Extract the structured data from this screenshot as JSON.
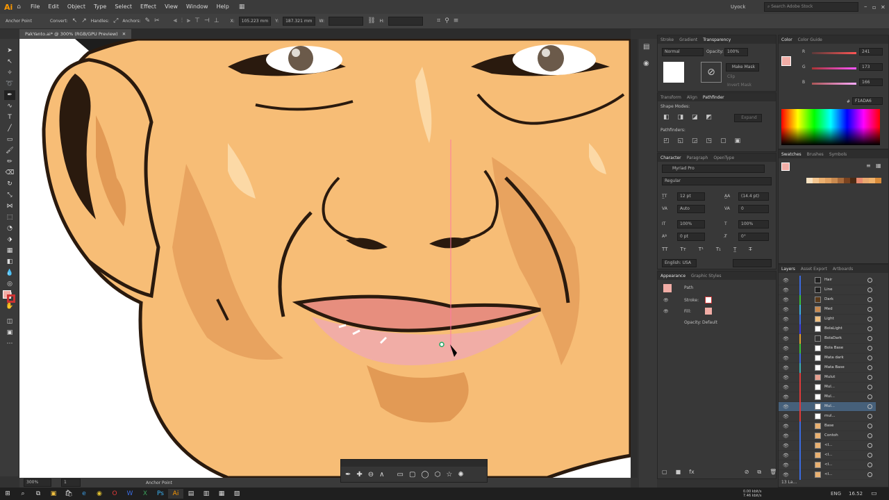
{
  "app": {
    "logo": "Ai",
    "user": "Uyock",
    "search_placeholder": "Search Adobe Stock"
  },
  "menu": [
    "File",
    "Edit",
    "Object",
    "Type",
    "Select",
    "Effect",
    "View",
    "Window",
    "Help"
  ],
  "control_bar": {
    "tool_label": "Anchor Point",
    "convert": "Convert:",
    "handles": "Handles:",
    "anchors": "Anchors:",
    "x_label": "X:",
    "x_value": "105.223 mm",
    "y_label": "Y:",
    "y_value": "187.321 mm",
    "w_label": "W:",
    "h_label": "H:"
  },
  "document": {
    "tab": "PakYanto.ai* @ 300% (RGB/GPU Preview)",
    "zoom": "300%",
    "page": "1",
    "status_tool": "Anchor Point"
  },
  "transparency": {
    "tabs": [
      "Stroke",
      "Gradient",
      "Transparency"
    ],
    "blend_mode": "Normal",
    "opacity_label": "Opacity:",
    "opacity": "100%",
    "make_mask": "Make Mask",
    "clip": "Clip",
    "invert_mask": "Invert Mask"
  },
  "pathfinder": {
    "tabs": [
      "Transform",
      "Align",
      "Pathfinder"
    ],
    "shape_modes": "Shape Modes:",
    "pathfinders": "Pathfinders:",
    "expand": "Expand"
  },
  "character": {
    "tabs": [
      "Character",
      "Paragraph",
      "OpenType"
    ],
    "font": "Myriad Pro",
    "style": "Regular",
    "size": "12 pt",
    "leading": "(14.4 pt)",
    "kerning": "Auto",
    "tracking": "0",
    "vscale": "100%",
    "hscale": "100%",
    "baseline": "0 pt",
    "rotate": "0°",
    "language": "English: USA"
  },
  "appearance": {
    "tabs": [
      "Appearance",
      "Graphic Styles"
    ],
    "target": "Path",
    "stroke_label": "Stroke:",
    "fill_label": "Fill:",
    "opacity_label": "Opacity:",
    "opacity_value": "Default"
  },
  "color": {
    "tabs": [
      "Color",
      "Color Guide"
    ],
    "r": "241",
    "g": "173",
    "b": "166",
    "hex": "F1ADA6",
    "fill_hex": "#F1ADA6"
  },
  "swatches": {
    "tabs": [
      "Swatches",
      "Brushes",
      "Symbols"
    ],
    "colors": [
      "#f9e3c2",
      "#f3c690",
      "#ebb070",
      "#e0a060",
      "#c98a4f",
      "#a86a3a",
      "#7a4320",
      "#4a2a14",
      "#e88a6e",
      "#e9a86f",
      "#f0b26b",
      "#d98c3a"
    ]
  },
  "layers": {
    "tabs": [
      "Layers",
      "Asset Export",
      "Artboards"
    ],
    "count": "13 La...",
    "items": [
      {
        "name": "Hair",
        "color": "#3a6be0",
        "thumb": "#222"
      },
      {
        "name": "Line",
        "color": "#3a6be0",
        "thumb": "#222"
      },
      {
        "name": "Dark",
        "color": "#3ac03a",
        "thumb": "#5a3a1a"
      },
      {
        "name": "Med",
        "color": "#3ab0e0",
        "thumb": "#c98a4f"
      },
      {
        "name": "Light",
        "color": "#3a6be0",
        "thumb": "#f0c080"
      },
      {
        "name": "BolaLight",
        "color": "#3a3ae0",
        "thumb": "#fff"
      },
      {
        "name": "BolaDark",
        "color": "#e0a030",
        "thumb": "#333"
      },
      {
        "name": "Bola Base",
        "color": "#3ac03a",
        "thumb": "#fff"
      },
      {
        "name": "Mata dark",
        "color": "#3a6be0",
        "thumb": "#fff"
      },
      {
        "name": "Mata Base",
        "color": "#3ab0b0",
        "thumb": "#fff"
      },
      {
        "name": "Mulut",
        "color": "#e03a3a",
        "thumb": "#e8a090"
      },
      {
        "name": "Mul...",
        "color": "#e03a3a",
        "thumb": "#fff"
      },
      {
        "name": "Mul...",
        "color": "#e03a3a",
        "thumb": "#fff"
      },
      {
        "name": "Mul...",
        "color": "#e03a3a",
        "thumb": "#fff",
        "selected": true
      },
      {
        "name": "mul...",
        "color": "#e03a3a",
        "thumb": "#fff"
      },
      {
        "name": "Base",
        "color": "#3a6be0",
        "thumb": "#e9b070"
      },
      {
        "name": "Contoh",
        "color": "#3a6be0",
        "thumb": "#e9b070"
      },
      {
        "name": "<I...",
        "color": "#3a6be0",
        "thumb": "#e9b070"
      },
      {
        "name": "<I...",
        "color": "#3a6be0",
        "thumb": "#e9b070"
      },
      {
        "name": "<I...",
        "color": "#3a6be0",
        "thumb": "#e9b070"
      },
      {
        "name": "<I...",
        "color": "#3a6be0",
        "thumb": "#e9b070"
      }
    ]
  },
  "taskbar": {
    "net_up": "0.00 kbit/s",
    "net_down": "7.46 kbit/s",
    "lang": "ENG",
    "time": "16.52"
  }
}
